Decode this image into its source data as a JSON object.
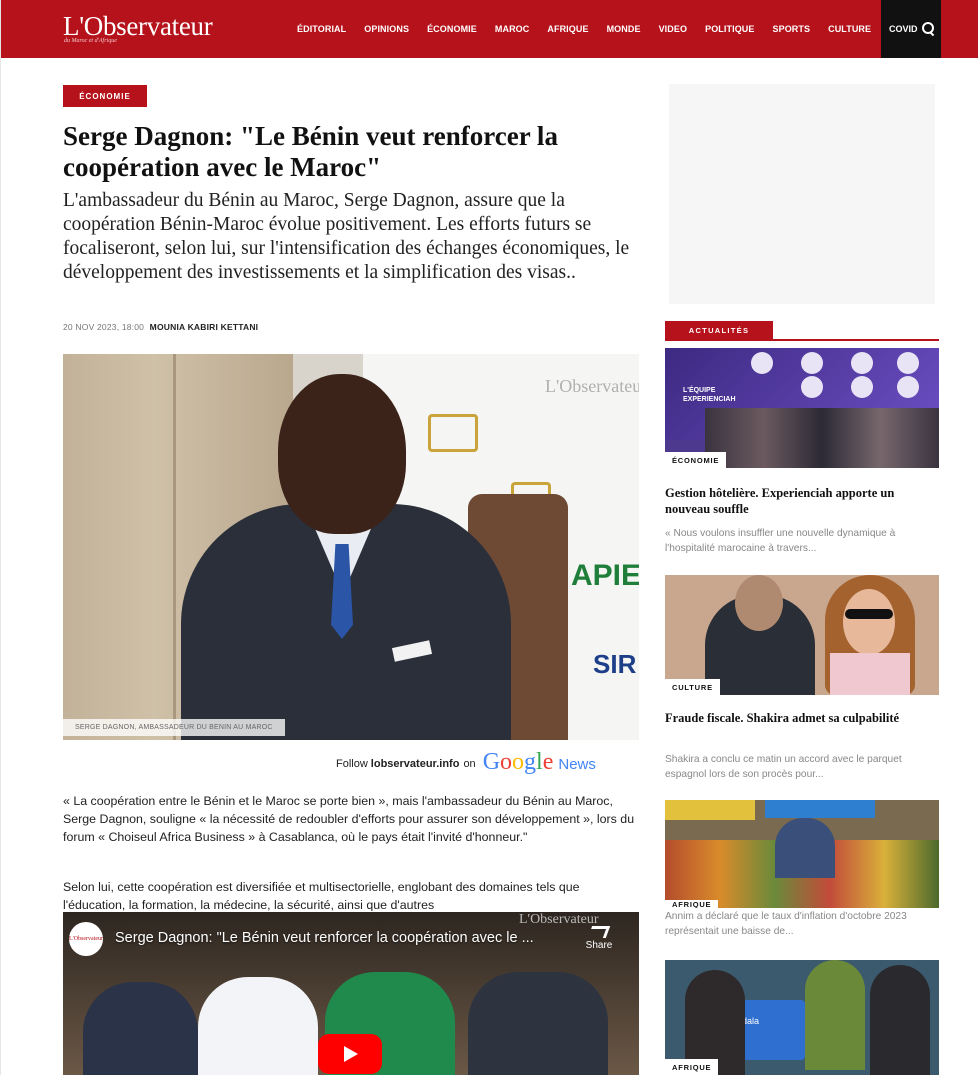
{
  "header": {
    "logo": "L'Observateur",
    "logo_tagline": "du Maroc et d'Afrique",
    "nav": [
      "ÉDITORIAL",
      "OPINIONS",
      "ÉCONOMIE",
      "MAROC",
      "AFRIQUE",
      "MONDE",
      "VIDEO",
      "POLITIQUE",
      "SPORTS",
      "CULTURE"
    ],
    "nav_highlight": "COVID",
    "search_icon": "search-icon"
  },
  "article": {
    "category": "ÉCONOMIE",
    "title": "Serge Dagnon: \"Le Bénin veut renforcer la coopération avec le Maroc\"",
    "standfirst": "L'ambassadeur du Bénin au Maroc, Serge Dagnon, assure que la coopération Bénin-Maroc évolue positivement. Les efforts futurs se focaliseront, selon lui, sur l'intensification des échanges économiques, le développement des investissements et la simplification des visas..",
    "date": "20 NOV 2023, 18:00",
    "author": "MOUNIA KABIRI KETTANI",
    "image_caption": "SERGE DAGNON, AMBASSADEUR DU BENIN AU MAROC",
    "image_logo": "L'Observateur",
    "image_sign_1": "APIE",
    "image_sign_2": "SIR",
    "follow_prefix": "Follow",
    "follow_site": "lobservateur.info",
    "follow_on": "on",
    "google_news_word": "Google",
    "google_news_suffix": "News",
    "paragraph_1": "« La coopération entre le Bénin et le Maroc se porte bien », mais l'ambassadeur du Bénin au Maroc, Serge Dagnon, souligne « la nécessité de redoubler d'efforts pour assurer son développement », lors du forum « Choiseul Africa Business » à Casablanca, où le pays était l'invité d'honneur.\"",
    "paragraph_2": "Selon lui, cette coopération est diversifiée et multisectorielle, englobant des domaines tels que l'éducation, la formation, la médecine, la sécurité, ainsi que d'autres",
    "video": {
      "channel_logo": "L'Observateur",
      "title": "Serge Dagnon: \"Le Bénin veut renforcer la coopération avec le ...",
      "share_label": "Share",
      "watermark": "L'Observateur"
    }
  },
  "sidebar": {
    "section_label": "ACTUALITÉS",
    "cards": [
      {
        "tag": "ÉCONOMIE",
        "image_text": "L'ÉQUIPE EXPERIENCIAH",
        "title": "Gestion hôtelière. Experienciah apporte un nouveau souffle",
        "excerpt": "« Nous voulons insuffler une nouvelle dynamique à l'hospitalité marocaine à travers..."
      },
      {
        "tag": "CULTURE",
        "title": "Fraude fiscale. Shakira admet sa culpabilité",
        "excerpt": "Shakira a conclu ce matin un accord avec le parquet espagnol lors de son procès pour..."
      },
      {
        "tag": "AFRIQUE",
        "title": "",
        "excerpt": "Annim a déclaré que le taux d'inflation d'octobre 2023 représentait une baisse de..."
      },
      {
        "tag": "AFRIQUE",
        "image_text": "Andala",
        "title": "",
        "excerpt": ""
      }
    ]
  },
  "colors": {
    "brand_red": "#b5121b",
    "nav_dark": "#111111"
  }
}
